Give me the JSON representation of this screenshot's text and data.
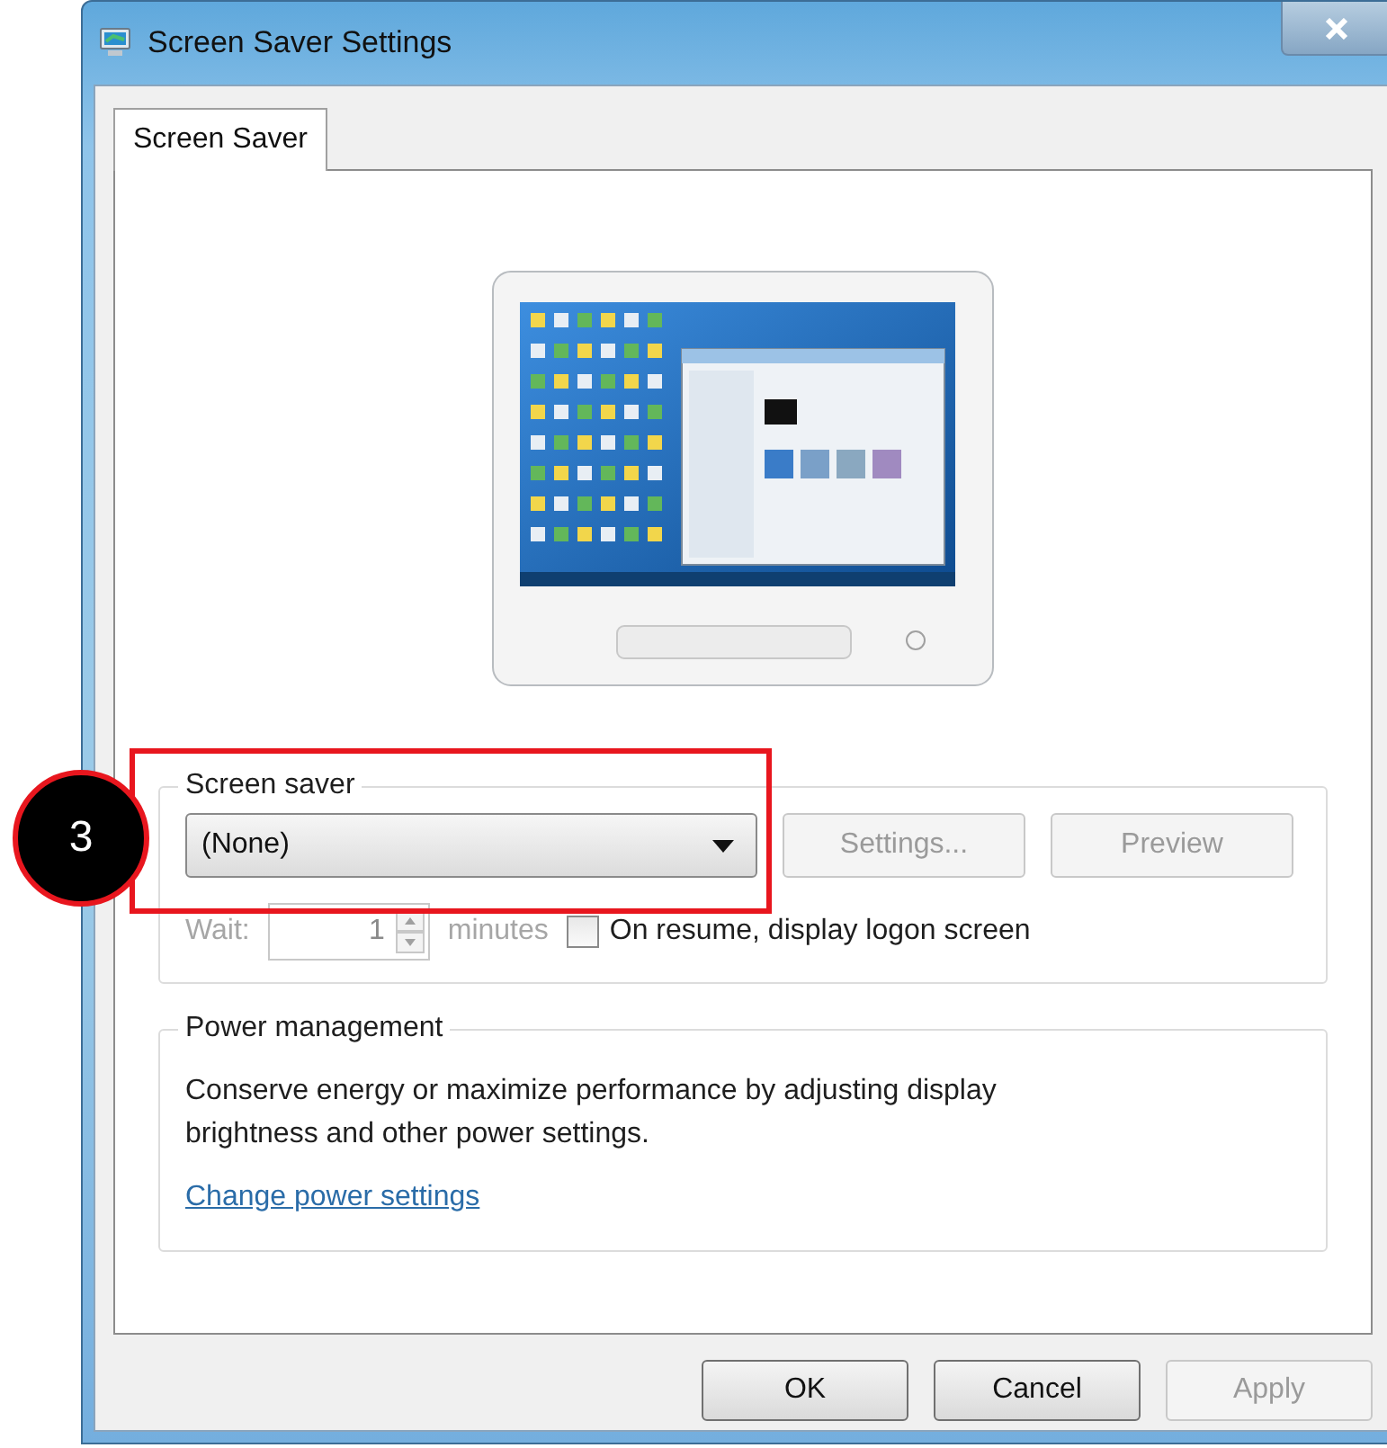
{
  "window": {
    "title": "Screen Saver Settings"
  },
  "tabs": [
    {
      "label": "Screen Saver",
      "selected": true
    }
  ],
  "callout": {
    "number": "3"
  },
  "screen_saver": {
    "title": "Screen saver",
    "dropdown": {
      "value": "(None)"
    },
    "buttons": [
      {
        "label": "Settings...",
        "disabled": true
      },
      {
        "label": "Preview",
        "disabled": true
      }
    ],
    "wait": {
      "label": "Wait:",
      "value": "1",
      "unit": "minutes",
      "disabled": true
    },
    "logon_checkbox": {
      "label": "On resume, display logon screen",
      "checked": false
    }
  },
  "power_management": {
    "title": "Power management",
    "description": "Conserve energy or maximize performance by adjusting display brightness and other power settings.",
    "link": "Change power settings"
  },
  "buttons": [
    {
      "label": "OK",
      "disabled": false
    },
    {
      "label": "Cancel",
      "disabled": false
    },
    {
      "label": "Apply",
      "disabled": true
    }
  ]
}
